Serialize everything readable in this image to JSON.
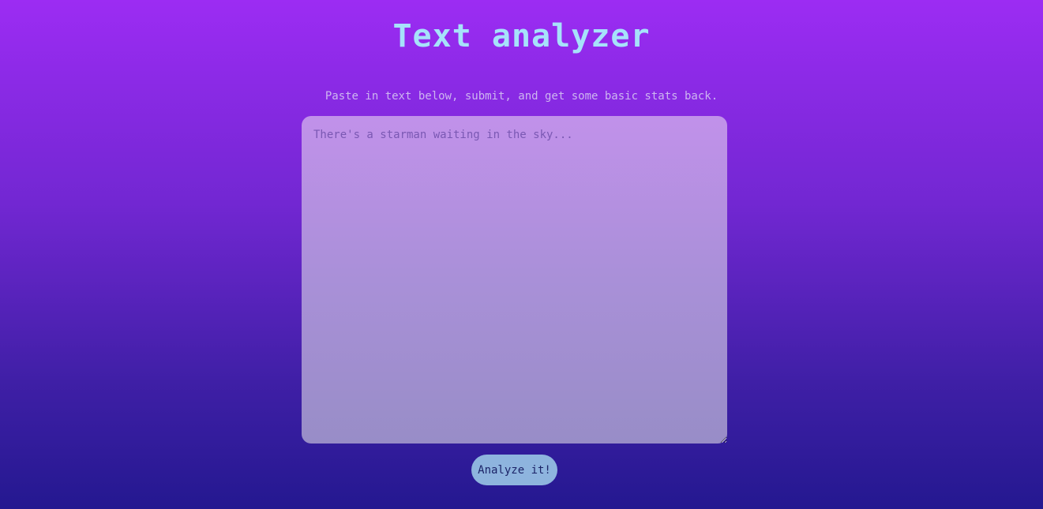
{
  "header": {
    "title": "Text analyzer",
    "subtitle": "Paste in text below, submit, and get some basic stats back."
  },
  "form": {
    "textarea": {
      "value": "",
      "placeholder": "There's a starman waiting in the sky..."
    },
    "submit_label": "Analyze it!"
  },
  "colors": {
    "background_top": "#9c2cf3",
    "background_bottom": "#241890",
    "title": "#a6e2fa",
    "subtitle": "#cdb6f0",
    "textarea_top": "#c191ea",
    "textarea_bottom": "#988dc7",
    "button_background": "#8eb4de",
    "button_text": "#1c2468"
  }
}
